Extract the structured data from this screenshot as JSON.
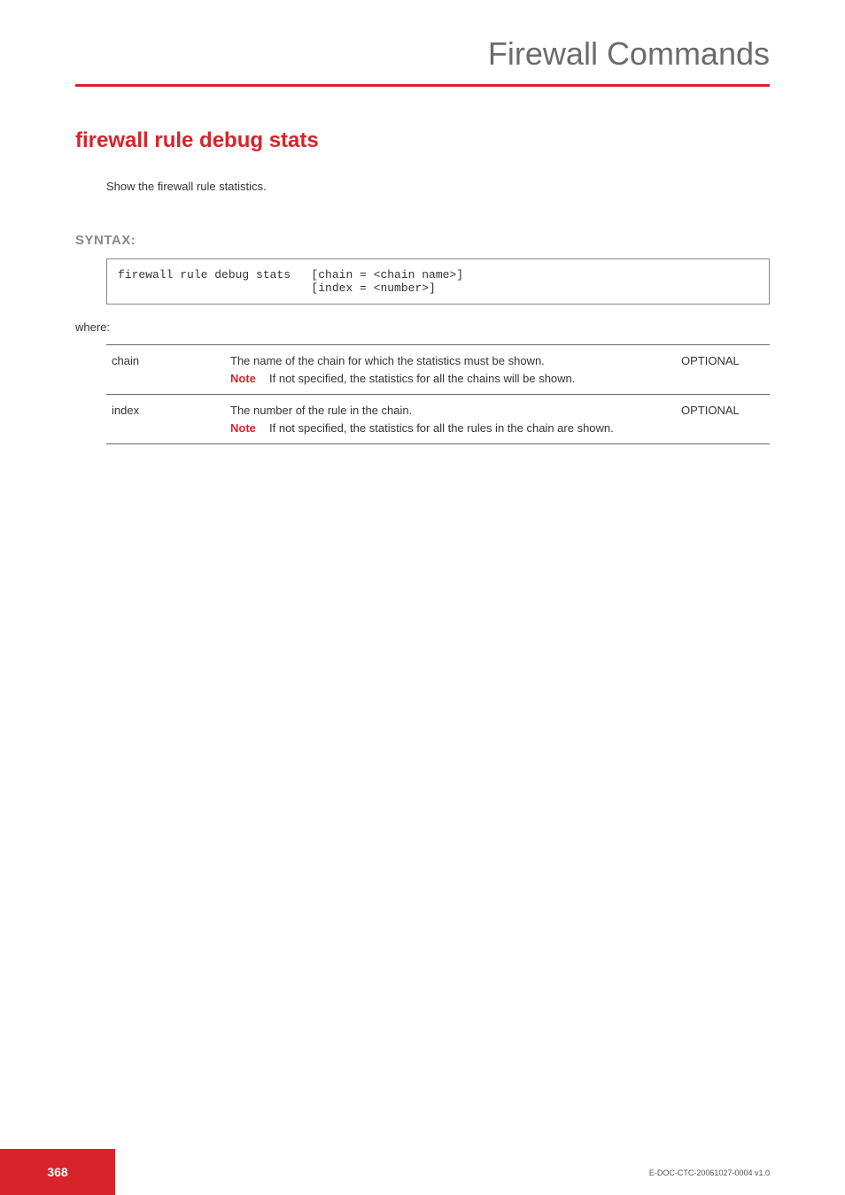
{
  "header": {
    "title": "Firewall Commands"
  },
  "page": {
    "title": "firewall rule debug stats",
    "description": "Show the firewall rule statistics."
  },
  "syntax": {
    "label": "SYNTAX:",
    "code": "firewall rule debug stats   [chain = <chain name>]\n                            [index = <number>]",
    "where_label": "where:"
  },
  "params": [
    {
      "name": "chain",
      "desc": "The name of the chain for which the statistics must be shown.",
      "note_label": "Note",
      "note_text": "If not specified, the statistics for all the chains will be shown.",
      "optional": "OPTIONAL"
    },
    {
      "name": "index",
      "desc": "The number of the rule in the chain.",
      "note_label": "Note",
      "note_text": "If not specified, the statistics for all the rules in the chain are shown.",
      "optional": "OPTIONAL"
    }
  ],
  "footer": {
    "page_number": "368",
    "doc_id": "E-DOC-CTC-20061027-0004 v1.0"
  }
}
